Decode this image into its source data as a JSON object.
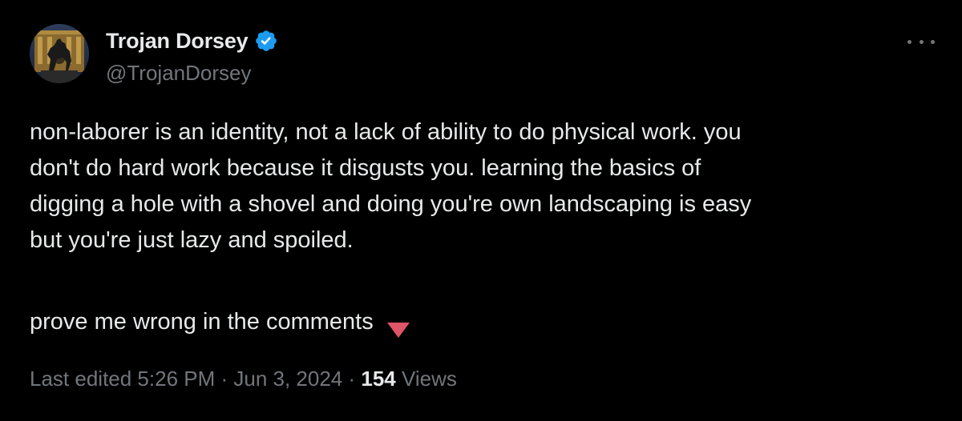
{
  "author": {
    "display_name": "Trojan Dorsey",
    "handle": "@TrojanDorsey",
    "verified": true,
    "verified_color": "#1d9bf0"
  },
  "tweet": {
    "text": "non-laborer is an identity, not a lack of ability to do physical work. you\ndon't do hard work because it disgusts you. learning the basics of\ndigging a hole with a shovel and doing you're own landscaping is easy\nbut you're just lazy and spoiled.",
    "cta": "prove me wrong in the comments",
    "cta_icon": "down-triangle-icon",
    "cta_icon_color": "#dd5566"
  },
  "meta": {
    "edited_time": "Last edited 5:26 PM",
    "separator": " · ",
    "date": "Jun 3, 2024",
    "views_count": "154",
    "views_label": " Views"
  },
  "colors": {
    "background": "#000000",
    "primary_text": "#e7e9ea",
    "secondary_text": "#71767b"
  }
}
